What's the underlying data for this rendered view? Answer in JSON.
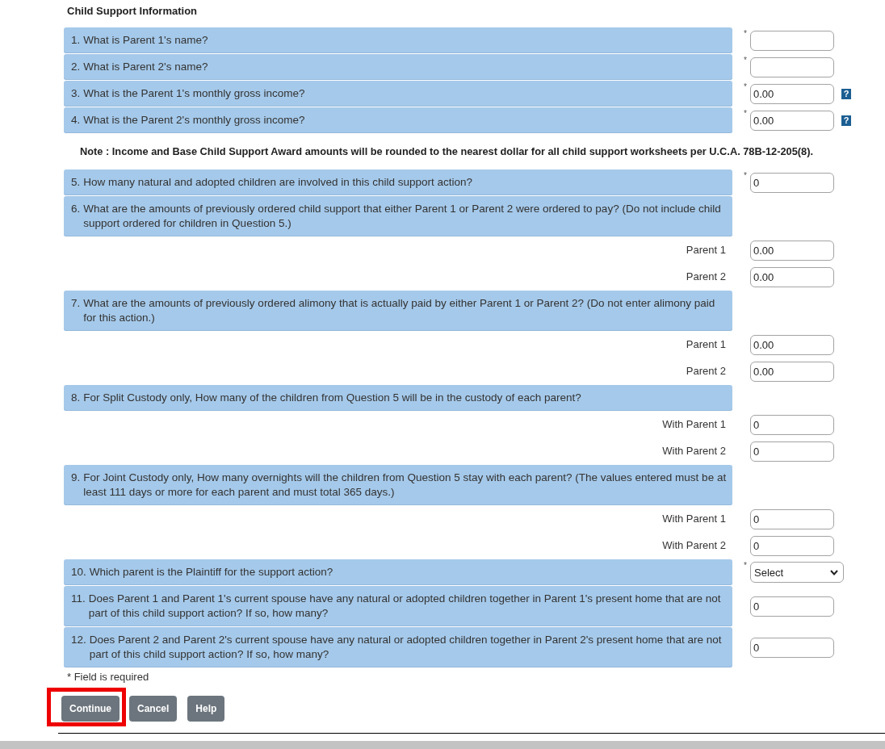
{
  "form": {
    "title": "Child Support Information",
    "items": [
      {
        "kind": "question",
        "number": "1.",
        "text": "What is Parent 1's name?",
        "required_mark": "*",
        "field": {
          "kind": "input"
        }
      },
      {
        "kind": "question",
        "number": "2.",
        "text": "What is Parent 2's name?",
        "required_mark": "*",
        "field": {
          "kind": "input"
        }
      },
      {
        "kind": "question",
        "number": "3.",
        "text": "What is the Parent 1's monthly gross income?",
        "required_mark": "*",
        "field": {
          "kind": "input",
          "value": "0.00"
        },
        "help": "?"
      },
      {
        "kind": "question",
        "number": "4.",
        "text": "What is the Parent 2's monthly gross income?",
        "required_mark": "*",
        "field": {
          "kind": "input",
          "value": "0.00"
        },
        "help": "?"
      },
      {
        "kind": "note",
        "text": "Note : Income and Base Child Support Award amounts will be rounded to the nearest dollar for all child support worksheets per U.C.A. 78B-12-205(8)."
      },
      {
        "kind": "question",
        "number": "5.",
        "text": "How many natural and adopted children are involved in this child support action?",
        "required_mark": "*",
        "field": {
          "kind": "input",
          "value": "0"
        }
      },
      {
        "kind": "question",
        "number": "6.",
        "text": "What are the amounts of previously ordered child support that either Parent 1 or Parent 2 were ordered to pay? (Do not include child support ordered for children in Question 5.)",
        "subfields": [
          {
            "label": "Parent 1",
            "value": "0.00"
          },
          {
            "label": "Parent 2",
            "value": "0.00"
          }
        ]
      },
      {
        "kind": "question",
        "number": "7.",
        "text": "What are the amounts of previously ordered alimony that is actually paid by either Parent 1 or Parent 2? (Do not enter alimony paid for this action.)",
        "subfields": [
          {
            "label": "Parent 1",
            "value": "0.00"
          },
          {
            "label": "Parent 2",
            "value": "0.00"
          }
        ]
      },
      {
        "kind": "question",
        "number": "8.",
        "text": "For Split Custody only, How many of the children from Question 5 will be in the custody of each parent?",
        "subfields": [
          {
            "label": "With Parent 1",
            "value": "0"
          },
          {
            "label": "With Parent 2",
            "value": "0"
          }
        ]
      },
      {
        "kind": "question",
        "number": "9.",
        "text": "For Joint Custody only, How many overnights will the children from Question 5 stay with each parent? (The values entered must be at least 111 days or more for each parent and must total 365 days.)",
        "subfields": [
          {
            "label": "With Parent 1",
            "value": "0"
          },
          {
            "label": "With Parent 2",
            "value": "0"
          }
        ]
      },
      {
        "kind": "question",
        "number": "10.",
        "text": "Which parent is the Plaintiff for the support action?",
        "required_mark": "*",
        "field": {
          "kind": "select",
          "value": "Select"
        }
      },
      {
        "kind": "question",
        "number": "11.",
        "text": "Does Parent 1 and Parent 1's current spouse have any natural or adopted children together in Parent 1's present home that are not part of this child support action? If so, how many?",
        "field": {
          "kind": "input",
          "value": "0"
        }
      },
      {
        "kind": "question",
        "number": "12.",
        "text": "Does Parent 2 and Parent 2's current spouse have any natural or adopted children together in Parent 2's present home that are not part of this child support action? If so, how many?",
        "field": {
          "kind": "input",
          "value": "0"
        }
      }
    ],
    "required_note": "* Field is required"
  },
  "buttons": [
    {
      "label": "Continue",
      "highlighted": true
    },
    {
      "label": "Cancel",
      "highlighted": false
    },
    {
      "label": "Help",
      "highlighted": false
    }
  ]
}
